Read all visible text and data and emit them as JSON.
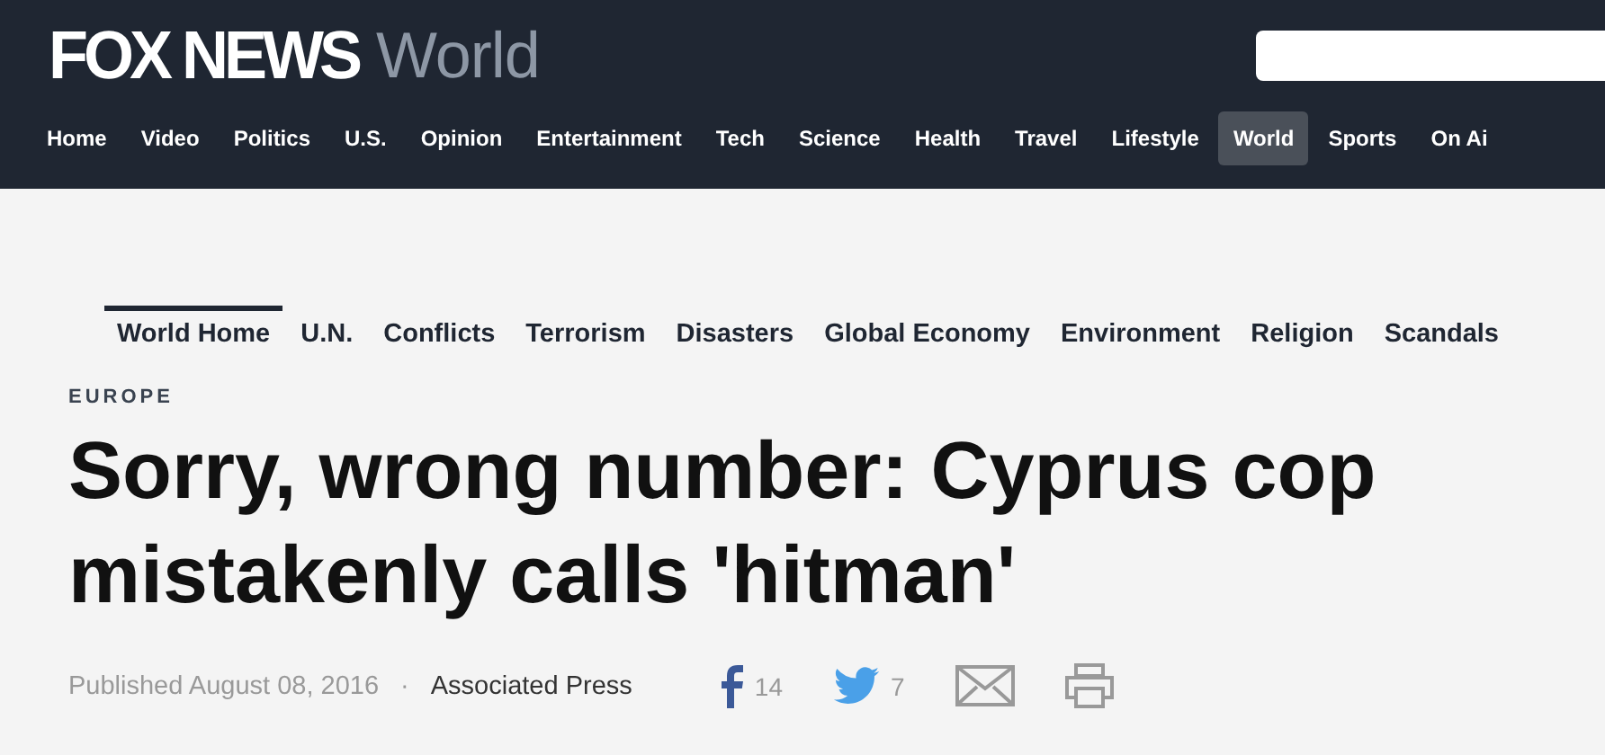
{
  "header": {
    "logo": "FOX NEWS",
    "section": "World"
  },
  "nav": [
    {
      "label": "Home",
      "selected": false
    },
    {
      "label": "Video",
      "selected": false
    },
    {
      "label": "Politics",
      "selected": false
    },
    {
      "label": "U.S.",
      "selected": false
    },
    {
      "label": "Opinion",
      "selected": false
    },
    {
      "label": "Entertainment",
      "selected": false
    },
    {
      "label": "Tech",
      "selected": false
    },
    {
      "label": "Science",
      "selected": false
    },
    {
      "label": "Health",
      "selected": false
    },
    {
      "label": "Travel",
      "selected": false
    },
    {
      "label": "Lifestyle",
      "selected": false
    },
    {
      "label": "World",
      "selected": true
    },
    {
      "label": "Sports",
      "selected": false
    },
    {
      "label": "On Ai",
      "selected": false
    }
  ],
  "subnav": [
    {
      "label": "World Home",
      "selected": true
    },
    {
      "label": "U.N.",
      "selected": false
    },
    {
      "label": "Conflicts",
      "selected": false
    },
    {
      "label": "Terrorism",
      "selected": false
    },
    {
      "label": "Disasters",
      "selected": false
    },
    {
      "label": "Global Economy",
      "selected": false
    },
    {
      "label": "Environment",
      "selected": false
    },
    {
      "label": "Religion",
      "selected": false
    },
    {
      "label": "Scandals",
      "selected": false
    }
  ],
  "article": {
    "category": "EUROPE",
    "headline": "Sorry, wrong number: Cyprus cop mistakenly calls 'hitman'",
    "published": "Published August 08, 2016",
    "separator": "·",
    "source": "Associated Press",
    "share": [
      {
        "kind": "facebook",
        "count": "14"
      },
      {
        "kind": "twitter",
        "count": "7"
      },
      {
        "kind": "email"
      },
      {
        "kind": "print"
      }
    ]
  }
}
